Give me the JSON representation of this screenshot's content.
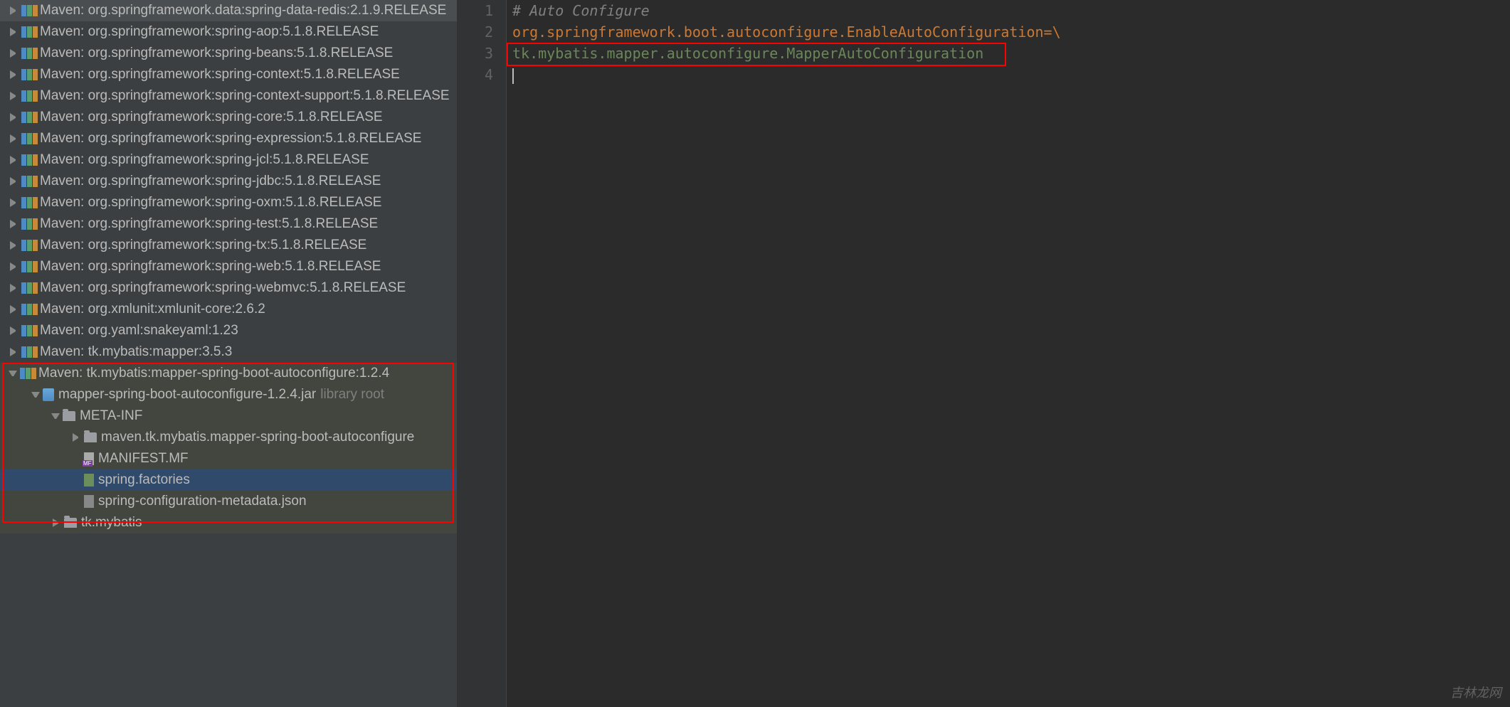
{
  "tree": {
    "items": [
      {
        "indent": 12,
        "arrow": "right",
        "icon": "lib",
        "label": "Maven: org.springframework.data:spring-data-redis:2.1.9.RELEASE"
      },
      {
        "indent": 12,
        "arrow": "right",
        "icon": "lib",
        "label": "Maven: org.springframework:spring-aop:5.1.8.RELEASE"
      },
      {
        "indent": 12,
        "arrow": "right",
        "icon": "lib",
        "label": "Maven: org.springframework:spring-beans:5.1.8.RELEASE"
      },
      {
        "indent": 12,
        "arrow": "right",
        "icon": "lib",
        "label": "Maven: org.springframework:spring-context:5.1.8.RELEASE"
      },
      {
        "indent": 12,
        "arrow": "right",
        "icon": "lib",
        "label": "Maven: org.springframework:spring-context-support:5.1.8.RELEASE"
      },
      {
        "indent": 12,
        "arrow": "right",
        "icon": "lib",
        "label": "Maven: org.springframework:spring-core:5.1.8.RELEASE"
      },
      {
        "indent": 12,
        "arrow": "right",
        "icon": "lib",
        "label": "Maven: org.springframework:spring-expression:5.1.8.RELEASE"
      },
      {
        "indent": 12,
        "arrow": "right",
        "icon": "lib",
        "label": "Maven: org.springframework:spring-jcl:5.1.8.RELEASE"
      },
      {
        "indent": 12,
        "arrow": "right",
        "icon": "lib",
        "label": "Maven: org.springframework:spring-jdbc:5.1.8.RELEASE"
      },
      {
        "indent": 12,
        "arrow": "right",
        "icon": "lib",
        "label": "Maven: org.springframework:spring-oxm:5.1.8.RELEASE"
      },
      {
        "indent": 12,
        "arrow": "right",
        "icon": "lib",
        "label": "Maven: org.springframework:spring-test:5.1.8.RELEASE"
      },
      {
        "indent": 12,
        "arrow": "right",
        "icon": "lib",
        "label": "Maven: org.springframework:spring-tx:5.1.8.RELEASE"
      },
      {
        "indent": 12,
        "arrow": "right",
        "icon": "lib",
        "label": "Maven: org.springframework:spring-web:5.1.8.RELEASE"
      },
      {
        "indent": 12,
        "arrow": "right",
        "icon": "lib",
        "label": "Maven: org.springframework:spring-webmvc:5.1.8.RELEASE"
      },
      {
        "indent": 12,
        "arrow": "right",
        "icon": "lib",
        "label": "Maven: org.xmlunit:xmlunit-core:2.6.2"
      },
      {
        "indent": 12,
        "arrow": "right",
        "icon": "lib",
        "label": "Maven: org.yaml:snakeyaml:1.23"
      },
      {
        "indent": 12,
        "arrow": "right",
        "icon": "lib",
        "label": "Maven: tk.mybatis:mapper:3.5.3"
      },
      {
        "indent": 12,
        "arrow": "down",
        "icon": "lib",
        "label": "Maven: tk.mybatis:mapper-spring-boot-autoconfigure:1.2.4",
        "hl": true
      },
      {
        "indent": 44,
        "arrow": "down",
        "icon": "jar",
        "label": "mapper-spring-boot-autoconfigure-1.2.4.jar",
        "suffix": "library root",
        "hl": true
      },
      {
        "indent": 72,
        "arrow": "down",
        "icon": "folder",
        "label": "META-INF",
        "hl": true
      },
      {
        "indent": 100,
        "arrow": "right",
        "icon": "folder",
        "label": "maven.tk.mybatis.mapper-spring-boot-autoconfigure",
        "hl": true
      },
      {
        "indent": 100,
        "arrow": "none",
        "icon": "mf",
        "label": "MANIFEST.MF",
        "hl": true
      },
      {
        "indent": 100,
        "arrow": "none",
        "icon": "sf",
        "label": "spring.factories",
        "hl": true,
        "selected": true
      },
      {
        "indent": 100,
        "arrow": "none",
        "icon": "json",
        "label": "spring-configuration-metadata.json",
        "hl": true
      },
      {
        "indent": 72,
        "arrow": "right",
        "icon": "folder",
        "label": "tk.mybatis",
        "hl": true
      }
    ]
  },
  "editor": {
    "gutter": [
      "1",
      "2",
      "3",
      "4"
    ],
    "line1_comment": "# Auto Configure",
    "line2_key": "org.springframework.boot.autoconfigure.EnableAutoConfiguration",
    "line2_eq_slash": "=\\",
    "line3_value": "tk.mybatis.mapper.autoconfigure.MapperAutoConfiguration"
  },
  "watermark": "吉林龙网"
}
